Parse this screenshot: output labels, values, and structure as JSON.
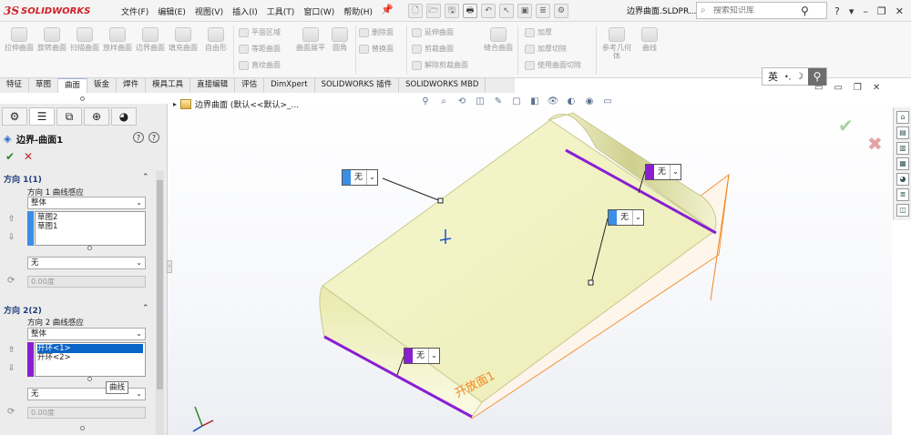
{
  "app": {
    "logo_prefix": "3S",
    "logo_text": "SOLIDWORKS",
    "doc_title": "边界曲面.SLDPR...",
    "search_placeholder": "搜索知识库",
    "menu": [
      "文件(F)",
      "编辑(E)",
      "视图(V)",
      "插入(I)",
      "工具(T)",
      "窗口(W)",
      "帮助(H)"
    ]
  },
  "quickbar": {
    "icons": [
      "new-icon",
      "open-icon",
      "save-icon",
      "print-icon",
      "undo-icon",
      "select-icon",
      "rebuild-icon",
      "file-props-icon",
      "options-icon"
    ],
    "glyphs": [
      "🗋",
      "🗁",
      "🖫",
      "🖶",
      "↶",
      "↖",
      "▣",
      "≣",
      "⚙"
    ]
  },
  "window_controls": [
    "?",
    "▾",
    "–",
    "❐",
    "✕"
  ],
  "commands": {
    "big": [
      {
        "name": "extrude-surface",
        "label": "拉伸曲面"
      },
      {
        "name": "revolve-surface",
        "label": "旋转曲面"
      },
      {
        "name": "sweep-surface",
        "label": "扫描曲面"
      },
      {
        "name": "loft-surface",
        "label": "放样曲面"
      },
      {
        "name": "boundary-surface",
        "label": "边界曲面"
      },
      {
        "name": "fill-surface",
        "label": "填充曲面"
      },
      {
        "name": "freeform",
        "label": "自由形"
      }
    ],
    "col1": [
      "平面区域",
      "等距曲面",
      "直纹曲面"
    ],
    "mid_big": [
      {
        "name": "surface-flatten",
        "label": "曲面展平"
      },
      {
        "name": "fillet",
        "label": "圆角"
      }
    ],
    "col2": [
      "删除面",
      "替换面"
    ],
    "col3": [
      "延伸曲面",
      "剪裁曲面",
      "解除剪裁曲面"
    ],
    "knit": {
      "name": "knit-surface",
      "label": "缝合曲面"
    },
    "col4": [
      "加厚",
      "加厚切除",
      "使用曲面切除"
    ],
    "right_big": [
      {
        "name": "reference-geometry",
        "label": "参考几何体"
      },
      {
        "name": "curves",
        "label": "曲线"
      }
    ]
  },
  "tabs": [
    "特征",
    "草图",
    "曲面",
    "钣金",
    "焊件",
    "模具工具",
    "直接编辑",
    "评估",
    "DimXpert",
    "SOLIDWORKS 插件",
    "SOLIDWORKS MBD"
  ],
  "ime": {
    "lang": "英",
    "punct": "•,",
    "mode": "☽"
  },
  "property_manager": {
    "title": "边界-曲面1",
    "dir1": {
      "header": "方向 1(1)",
      "influence_label": "方向 1 曲线感应",
      "influence_value": "整体",
      "items": [
        "草图2",
        "草图1"
      ],
      "tangency": "无",
      "angle": "0.00度"
    },
    "dir2": {
      "header": "方向 2(2)",
      "influence_label": "方向 2 曲线感应",
      "influence_value": "整体",
      "items": [
        "开环<1>",
        "开环<2>"
      ],
      "tangency": "无",
      "angle": "0.00度"
    },
    "tooltip": "曲线"
  },
  "viewport": {
    "breadcrumb": "边界曲面 (默认<<默认>_...",
    "callout_value": "无",
    "surface_label": "开放面1"
  },
  "colors": {
    "accent": "#0a63c7",
    "dir1_bar": "#3a8ee6",
    "dir2_bar": "#8a1ed1",
    "surface": "#f1f1bd",
    "orange_edge": "#f08a24",
    "purple_edge": "#8a1ed1"
  }
}
